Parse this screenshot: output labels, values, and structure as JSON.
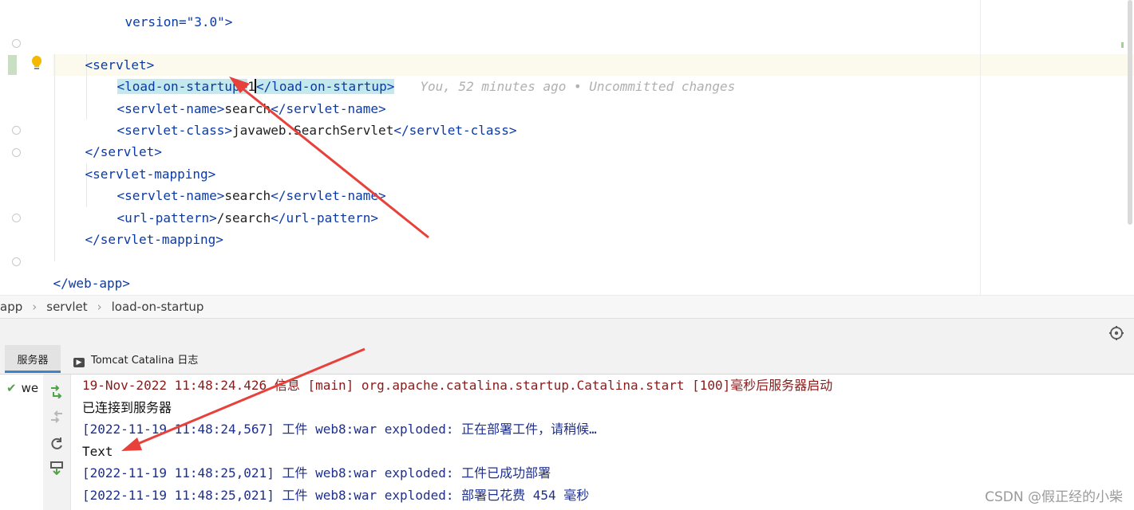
{
  "editor": {
    "lines": [
      {
        "text": "version=\"3.0\">"
      },
      {
        "text": ""
      },
      {
        "open": "<servlet>"
      },
      {
        "open": "<load-on-startup>",
        "value": "1",
        "close": "</load-on-startup>",
        "inlay": "You, 52 minutes ago • Uncommitted changes"
      },
      {
        "open": "<servlet-name>",
        "value": "search",
        "close": "</servlet-name>"
      },
      {
        "open": "<servlet-class>",
        "value": "javaweb.SearchServlet",
        "close": "</servlet-class>"
      },
      {
        "open": "</servlet>"
      },
      {
        "open": "<servlet-mapping>"
      },
      {
        "open": "<servlet-name>",
        "value": "search",
        "close": "</servlet-name>"
      },
      {
        "open": "<url-pattern>",
        "value": "/search",
        "close": "</url-pattern>"
      },
      {
        "open": "</servlet-mapping>"
      },
      {
        "text": ""
      },
      {
        "open": "</web-app>"
      }
    ]
  },
  "breadcrumb": [
    "app",
    "servlet",
    "load-on-startup"
  ],
  "tabs": {
    "servers": "服务器",
    "catalina": "Tomcat Catalina 日志"
  },
  "server_tree": {
    "item": "we"
  },
  "console": [
    {
      "text": "19-Nov-2022 11:48:24.426 信息 [main] org.apache.catalina.startup.Catalina.start [100]毫秒后服务器启动",
      "color": "red"
    },
    {
      "text": "已连接到服务器",
      "color": "black"
    },
    {
      "text": "[2022-11-19 11:48:24,567] 工件 web8:war exploded: 正在部署工件，请稍候…",
      "color": "blue"
    },
    {
      "text": "Text",
      "color": "black"
    },
    {
      "text": "[2022-11-19 11:48:25,021] 工件 web8:war exploded: 工件已成功部署",
      "color": "blue"
    },
    {
      "text": "[2022-11-19 11:48:25,021] 工件 web8:war exploded: 部署已花费 454 毫秒",
      "color": "blue"
    }
  ],
  "watermark": "CSDN @假正经的小柴",
  "colors": {
    "tag": "#0b3aa6",
    "annotation_arrow": "#e8403a",
    "console_red": "#8b1a1a",
    "console_blue": "#1e2f8c",
    "tab_accent": "#3c83cb"
  }
}
